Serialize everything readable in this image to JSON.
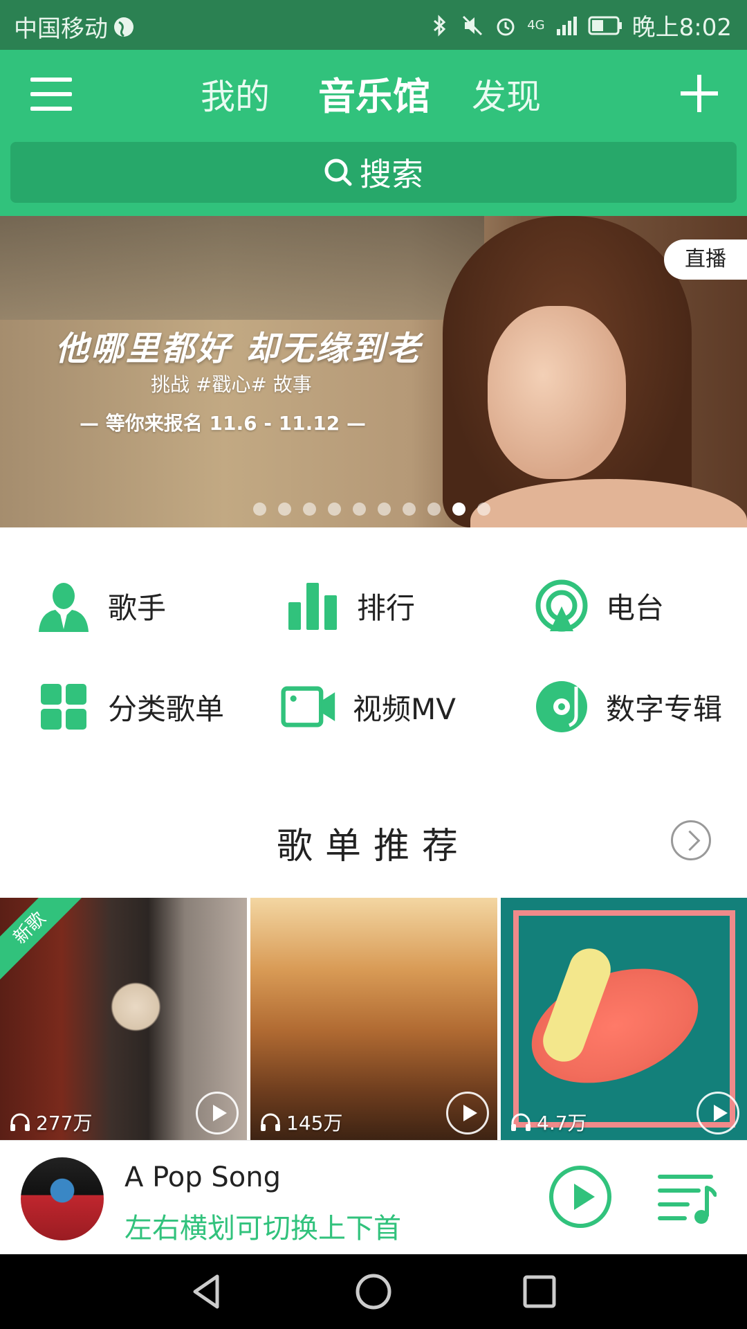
{
  "status_bar": {
    "carrier": "中国移动",
    "network": "4G",
    "time": "晚上8:02"
  },
  "header": {
    "tabs": [
      {
        "label": "我的",
        "active": false
      },
      {
        "label": "音乐馆",
        "active": true
      },
      {
        "label": "发现",
        "active": false
      }
    ],
    "search_label": "搜索",
    "menu_icon": "hamburger-menu-icon",
    "add_icon": "plus-icon"
  },
  "banner": {
    "title": "他哪里都好 却无缘到老",
    "subtitle": "挑战 #戳心# 故事",
    "date_line": "— 等你来报名 11.6 - 11.12 —",
    "badge": "直播",
    "dot_count": 10,
    "active_dot_index": 8
  },
  "categories": [
    {
      "label": "歌手",
      "icon": "singer-icon"
    },
    {
      "label": "排行",
      "icon": "chart-bars-icon"
    },
    {
      "label": "电台",
      "icon": "radio-icon"
    },
    {
      "label": "分类歌单",
      "icon": "grid-icon"
    },
    {
      "label": "视频MV",
      "icon": "video-camera-icon"
    },
    {
      "label": "数字专辑",
      "icon": "album-disc-icon"
    }
  ],
  "section": {
    "title": "歌单推荐"
  },
  "playlists": [
    {
      "count": "277万",
      "ribbon": "新歌"
    },
    {
      "count": "145万"
    },
    {
      "count": "4.7万"
    }
  ],
  "player": {
    "song": "A Pop Song",
    "hint": "左右横划可切换上下首"
  },
  "colors": {
    "accent": "#31c27c",
    "status_bar": "#2b8152",
    "search_bg": "#27a86a"
  }
}
